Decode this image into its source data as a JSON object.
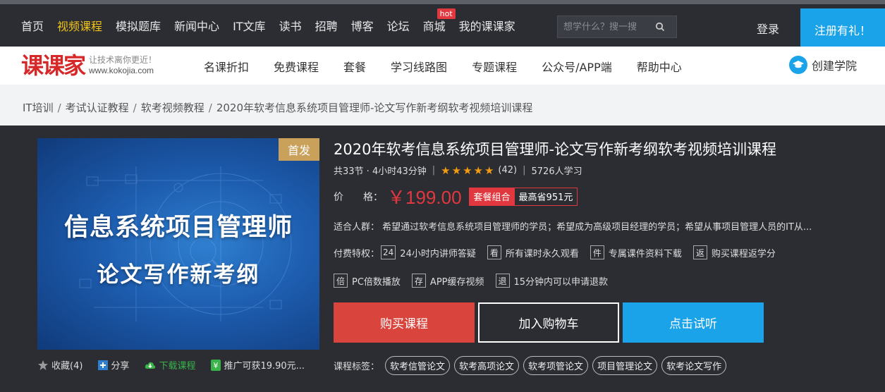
{
  "topnav": {
    "items": [
      "首页",
      "视频课程",
      "模拟题库",
      "新闻中心",
      "IT文库",
      "读书",
      "招聘",
      "博客",
      "论坛",
      "商城",
      "我的课课家"
    ],
    "active_index": 1,
    "hot_badge": "hot",
    "search_placeholder": "想学什么？搜一搜",
    "login": "登录",
    "register": "注册有礼！"
  },
  "logo": {
    "mark": "课课家",
    "slogan": "让技术离你更近！",
    "url": "www.kokojia.com"
  },
  "subnav": {
    "items": [
      "名课折扣",
      "免费课程",
      "套餐",
      "学习线路图",
      "专题课程",
      "公众号/APP端",
      "帮助中心"
    ],
    "create_academy": "创建学院"
  },
  "breadcrumb": [
    "IT培训",
    "考试认证教程",
    "软考视频教程",
    "2020年软考信息系统项目管理师-论文写作新考纲软考视频培训课程"
  ],
  "cover": {
    "line1": "信息系统项目管理师",
    "line2": "论文写作新考纲",
    "badge": "首发"
  },
  "cover_actions": {
    "favorite": "收藏(4)",
    "share": "分享",
    "download": "下载课程",
    "promote": "推广可获19.90元..."
  },
  "course": {
    "title": "2020年软考信息系统项目管理师-论文写作新考纲软考视频培训课程",
    "lessons": "共33节 · 4小时43分钟",
    "rating": 5,
    "reviews": "(42)",
    "students": "5726人学习",
    "price_label": "价　　格：",
    "price": "￥199.00",
    "combo_tag": "套餐组合",
    "combo_save": "最高省951元",
    "suitable": "适合人群：  希望通过软考信息系统项目管理师的学员；希望成为高级项目经理的学员；希望从事项目管理人员的IT从..."
  },
  "privileges": {
    "label": "付费特权：",
    "row1": [
      {
        "box": "24",
        "text": "24小时内讲师答疑"
      },
      {
        "box": "看",
        "text": "所有课时永久观看"
      },
      {
        "box": "件",
        "text": "专属课件资料下载"
      },
      {
        "box": "返",
        "text": "购买课程返学分"
      }
    ],
    "row2": [
      {
        "box": "倍",
        "text": "PC倍数播放"
      },
      {
        "box": "存",
        "text": "APP缓存视频"
      },
      {
        "box": "退",
        "text": "15分钟内可以申请退款"
      }
    ]
  },
  "buttons": {
    "buy": "购买课程",
    "cart": "加入购物车",
    "trial": "点击试听"
  },
  "tags": {
    "label": "课程标签：",
    "items": [
      "软考信管论文",
      "软考高项论文",
      "软考项管论文",
      "项目管理论文",
      "软考论文写作"
    ]
  },
  "colors": {
    "dark_bg": "#2b2d33",
    "accent_blue": "#1aa3e8",
    "accent_red": "#e0383e",
    "active_nav": "#f0c419"
  }
}
